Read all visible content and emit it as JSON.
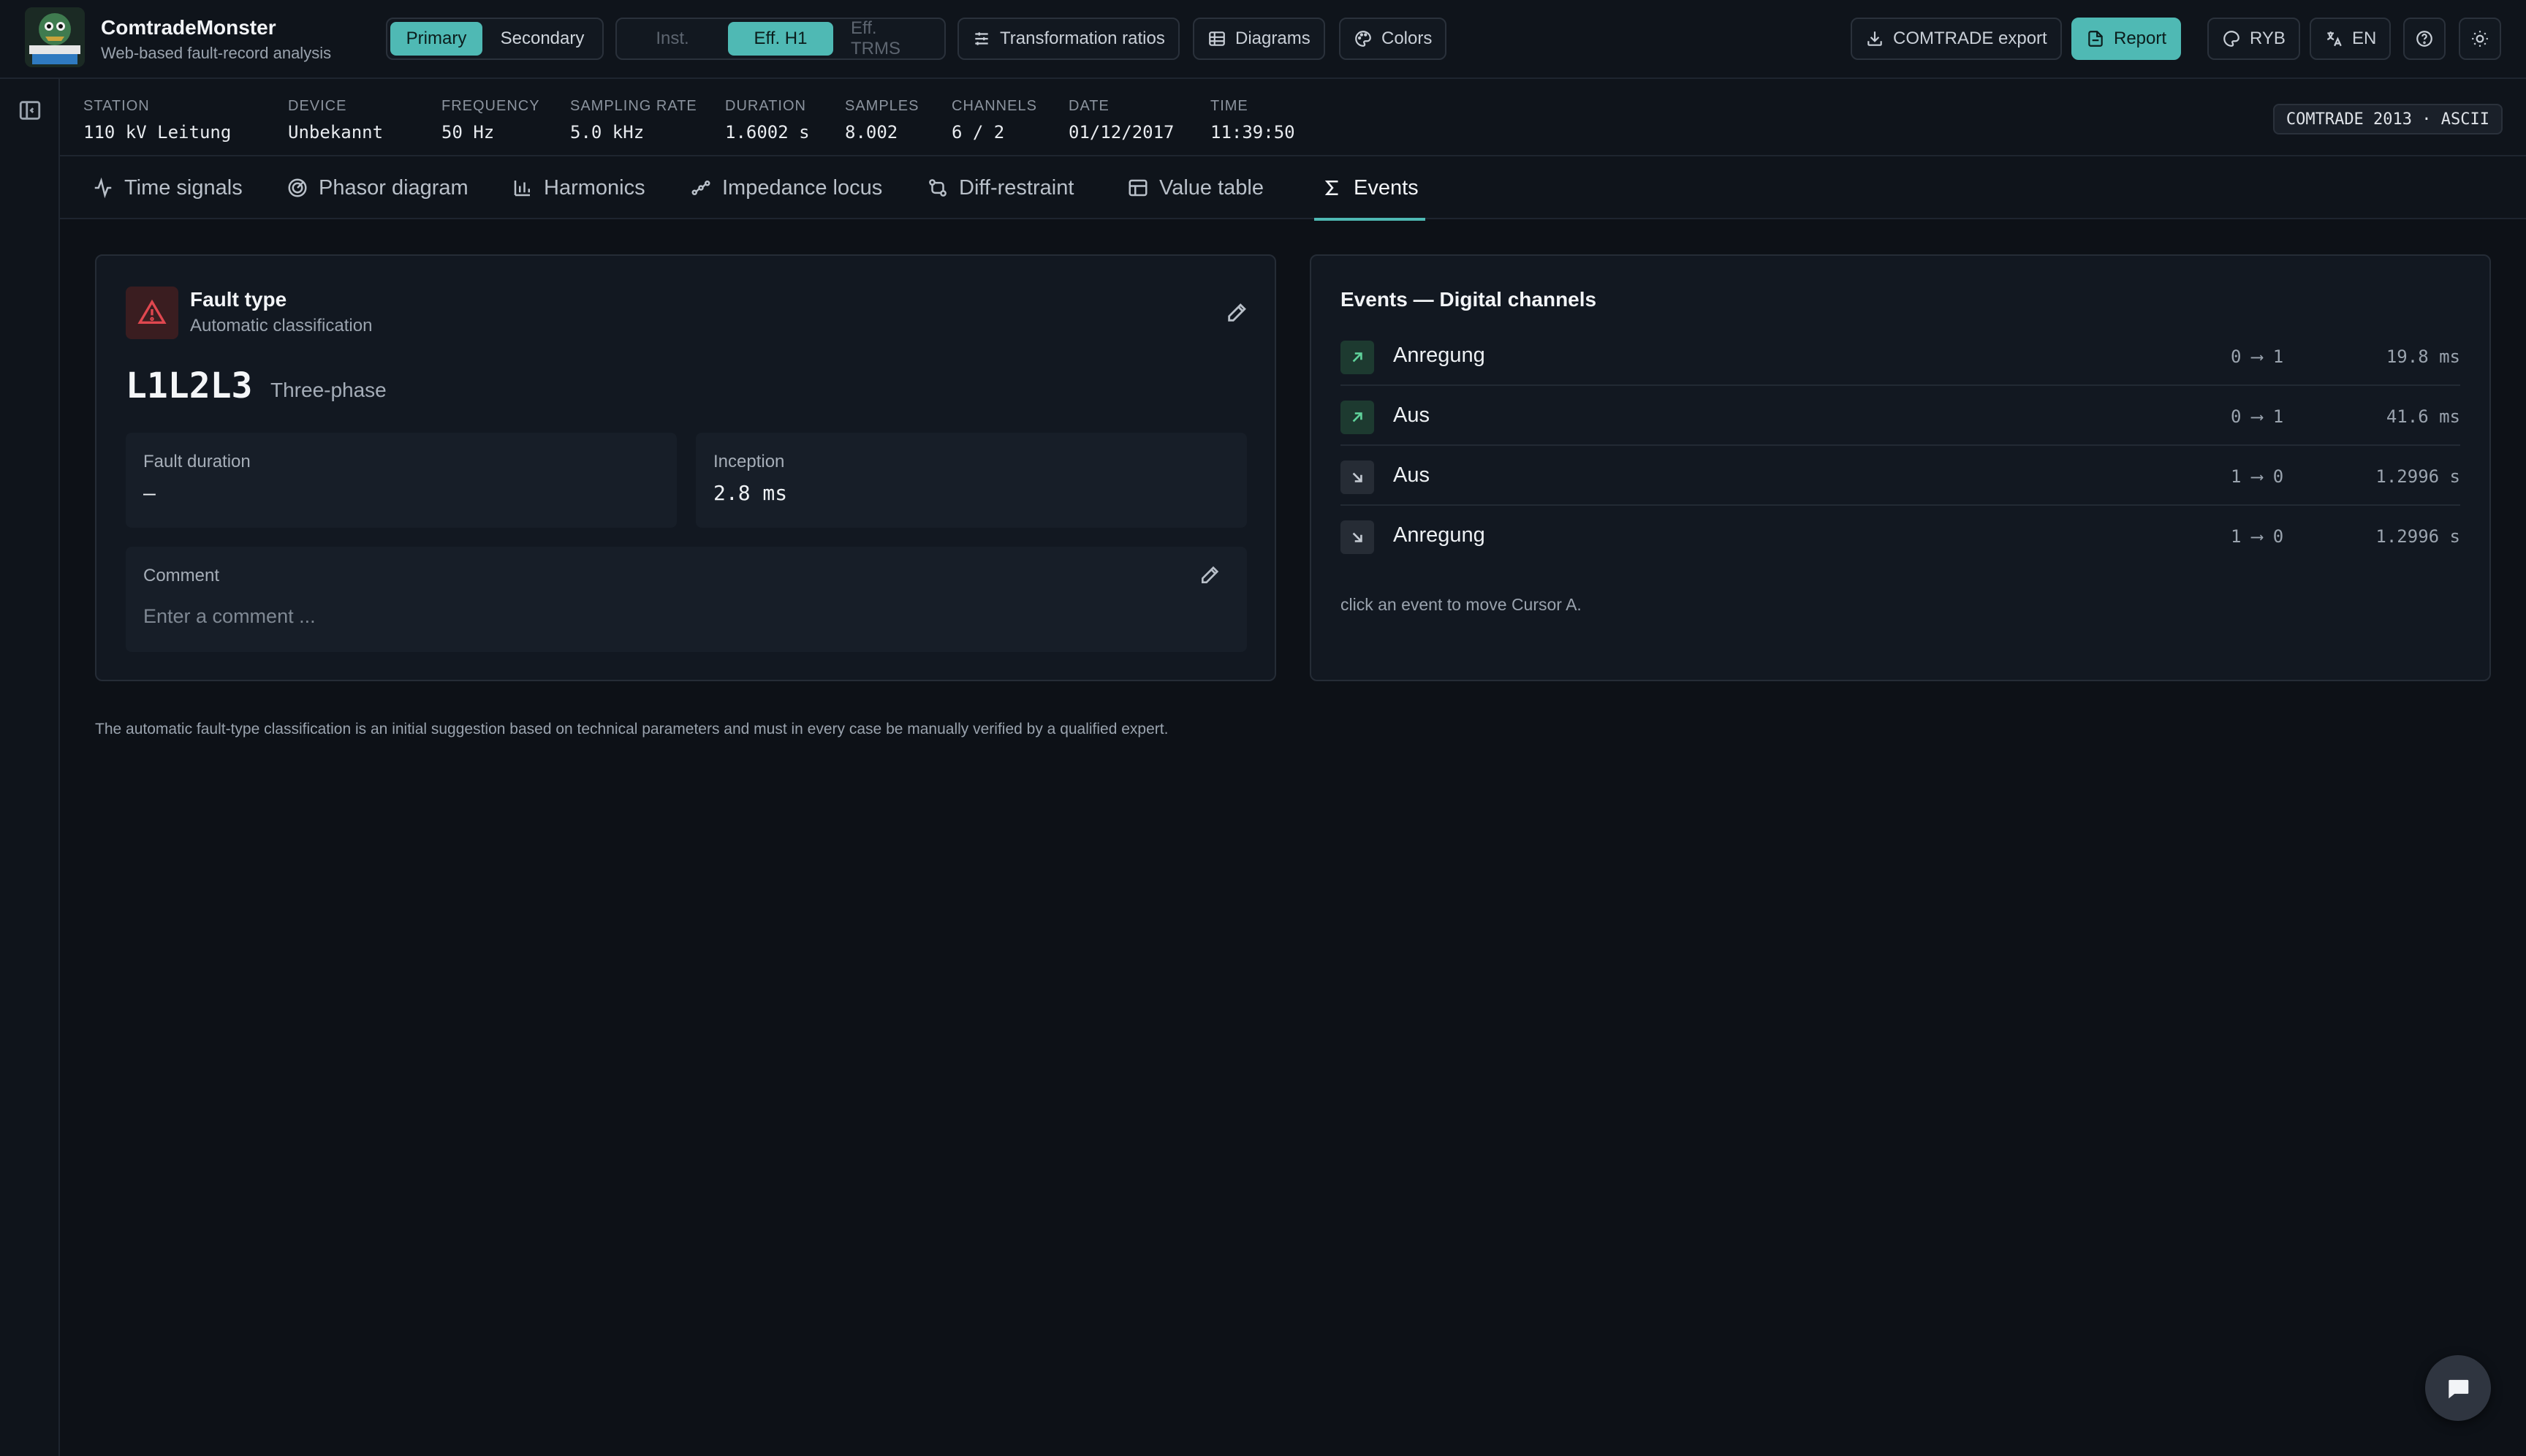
{
  "app": {
    "title": "ComtradeMonster",
    "subtitle": "Web-based fault-record analysis",
    "logo_text": "comtrade MONSTER"
  },
  "toolbar": {
    "view_mode": [
      {
        "label": "Primary",
        "active": true
      },
      {
        "label": "Secondary",
        "active": false
      }
    ],
    "value_mode": [
      {
        "label": "Inst.",
        "state": "disabled"
      },
      {
        "label": "Eff. H1",
        "state": "active"
      },
      {
        "label": "Eff. TRMS",
        "state": "disabled"
      }
    ],
    "transformation_label": "Transformation ratios",
    "diagrams_label": "Diagrams",
    "colors_label": "Colors",
    "export_label": "COMTRADE export",
    "report_label": "Report",
    "phase_label": "RYB",
    "language_label": "EN"
  },
  "meta": {
    "station": {
      "key": "STATION",
      "value": "110 kV Leitung"
    },
    "device": {
      "key": "DEVICE",
      "value": "Unbekannt"
    },
    "frequency": {
      "key": "FREQUENCY",
      "value": "50 Hz"
    },
    "sampling_rate": {
      "key": "SAMPLING RATE",
      "value": "5.0 kHz"
    },
    "duration": {
      "key": "DURATION",
      "value": "1.6002 s"
    },
    "samples": {
      "key": "SAMPLES",
      "value": "8.002"
    },
    "channels": {
      "key": "CHANNELS",
      "value": "6 / 2"
    },
    "date": {
      "key": "DATE",
      "value": "01/12/2017"
    },
    "time": {
      "key": "TIME",
      "value": "11:39:50"
    },
    "format_badge": "COMTRADE 2013 · ASCII"
  },
  "tabs": [
    {
      "label": "Time signals",
      "icon": "activity-icon"
    },
    {
      "label": "Phasor diagram",
      "icon": "target-icon"
    },
    {
      "label": "Harmonics",
      "icon": "bar-chart-icon"
    },
    {
      "label": "Impedance locus",
      "icon": "locus-icon"
    },
    {
      "label": "Diff-restraint",
      "icon": "git-compare-icon"
    },
    {
      "label": "Value table",
      "icon": "table-icon"
    },
    {
      "label": "Events",
      "icon": "sigma-icon",
      "active": true
    }
  ],
  "fault": {
    "title": "Fault type",
    "subtitle": "Automatic classification",
    "code": "L1L2L3",
    "phase": "Three-phase",
    "duration_label": "Fault duration",
    "duration_value": "–",
    "inception_label": "Inception",
    "inception_value": "2.8 ms",
    "comment_label": "Comment",
    "comment_placeholder": "Enter a comment ...",
    "comment_value": ""
  },
  "events": {
    "title": "Events — Digital channels",
    "rows": [
      {
        "name": "Anregung",
        "direction": "rise",
        "transition": "0 ⟶ 1",
        "time": "19.8 ms"
      },
      {
        "name": "Aus",
        "direction": "rise",
        "transition": "0 ⟶ 1",
        "time": "41.6 ms"
      },
      {
        "name": "Aus",
        "direction": "fall",
        "transition": "1 ⟶ 0",
        "time": "1.2996 s"
      },
      {
        "name": "Anregung",
        "direction": "fall",
        "transition": "1 ⟶ 0",
        "time": "1.2996 s"
      }
    ],
    "hint": "click an event to move Cursor A."
  },
  "disclaimer": "The automatic fault-type classification is an initial suggestion based on technical parameters and must in every case be manually verified by a qualified expert.",
  "colors": {
    "accent": "#4fb9b4",
    "danger": "#e0474f",
    "rise": "#5fd19a",
    "background": "#0d1117"
  }
}
